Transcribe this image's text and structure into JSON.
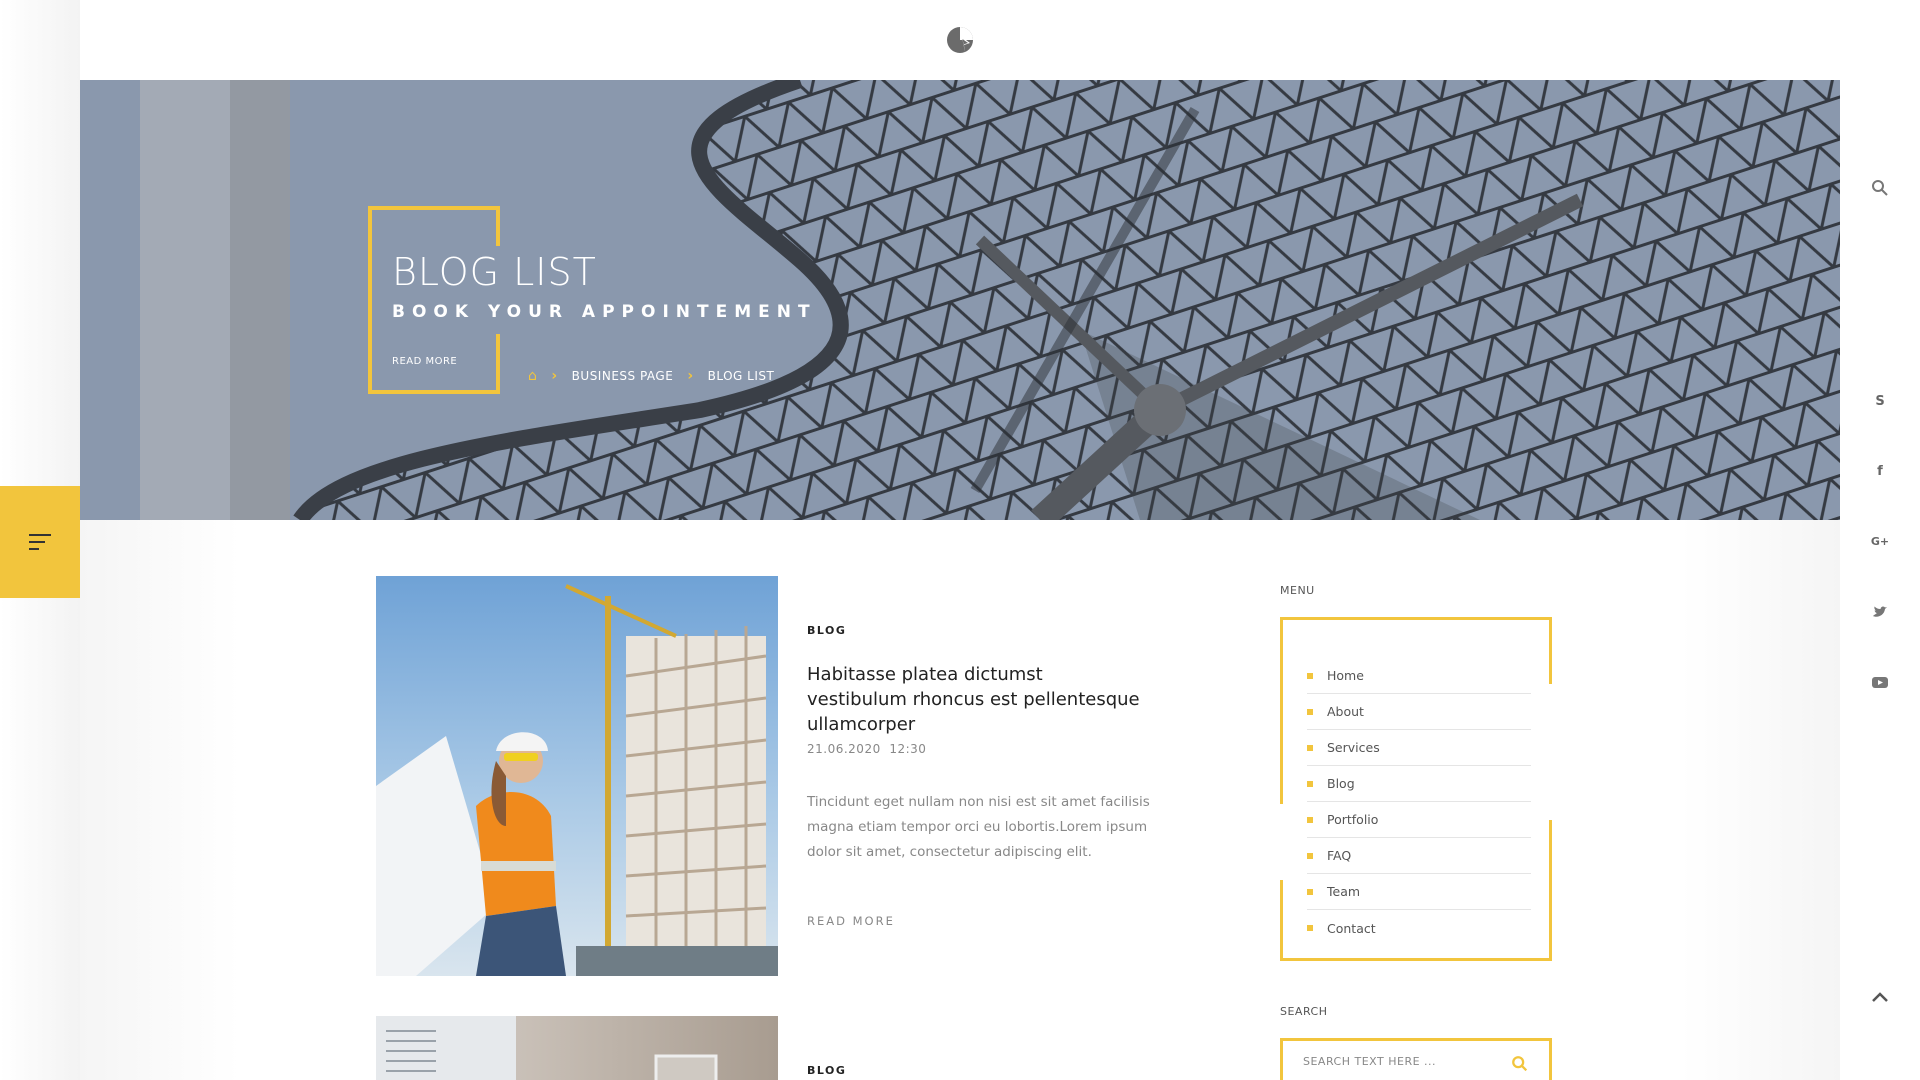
{
  "header": {
    "logo_icon": "brand-logo-icon"
  },
  "hero": {
    "title": "BLOG LIST",
    "subtitle": "BOOK YOUR APPOINTEMENT",
    "read_more": "READ MORE",
    "breadcrumb": {
      "home_icon": "home-icon",
      "items": [
        "BUSINESS PAGE",
        "BLOG LIST"
      ],
      "separator_icon": "chevron-right-icon"
    }
  },
  "side_toggle": {
    "icon": "menu-lines-icon"
  },
  "right_rail": {
    "icons": [
      "search-icon",
      "skype-icon",
      "facebook-icon",
      "google-plus-icon",
      "twitter-icon",
      "youtube-icon",
      "scroll-top-icon"
    ]
  },
  "posts": [
    {
      "category": "BLOG",
      "title": "Habitasse platea dictumst vestibulum rhoncus est pellentesque ullamcorper",
      "date": "21.06.2020",
      "time": "12:30",
      "excerpt": "Tincidunt eget nullam non nisi est sit amet facilisis magna etiam tempor orci eu lobortis.Lorem ipsum dolor sit amet, consectetur adipiscing elit.",
      "read_more": "READ MORE"
    },
    {
      "category": "BLOG"
    }
  ],
  "sidebar": {
    "menu_label": "MENU",
    "menu_items": [
      "Home",
      "About",
      "Services",
      "Blog",
      "Portfolio",
      "FAQ",
      "Team",
      "Contact"
    ],
    "search_label": "SEARCH",
    "search_placeholder": "SEARCH TEXT HERE ...",
    "search_icon": "search-icon"
  },
  "colors": {
    "accent": "#f2c53d",
    "text_dark": "#222222",
    "text_muted": "#888888"
  }
}
